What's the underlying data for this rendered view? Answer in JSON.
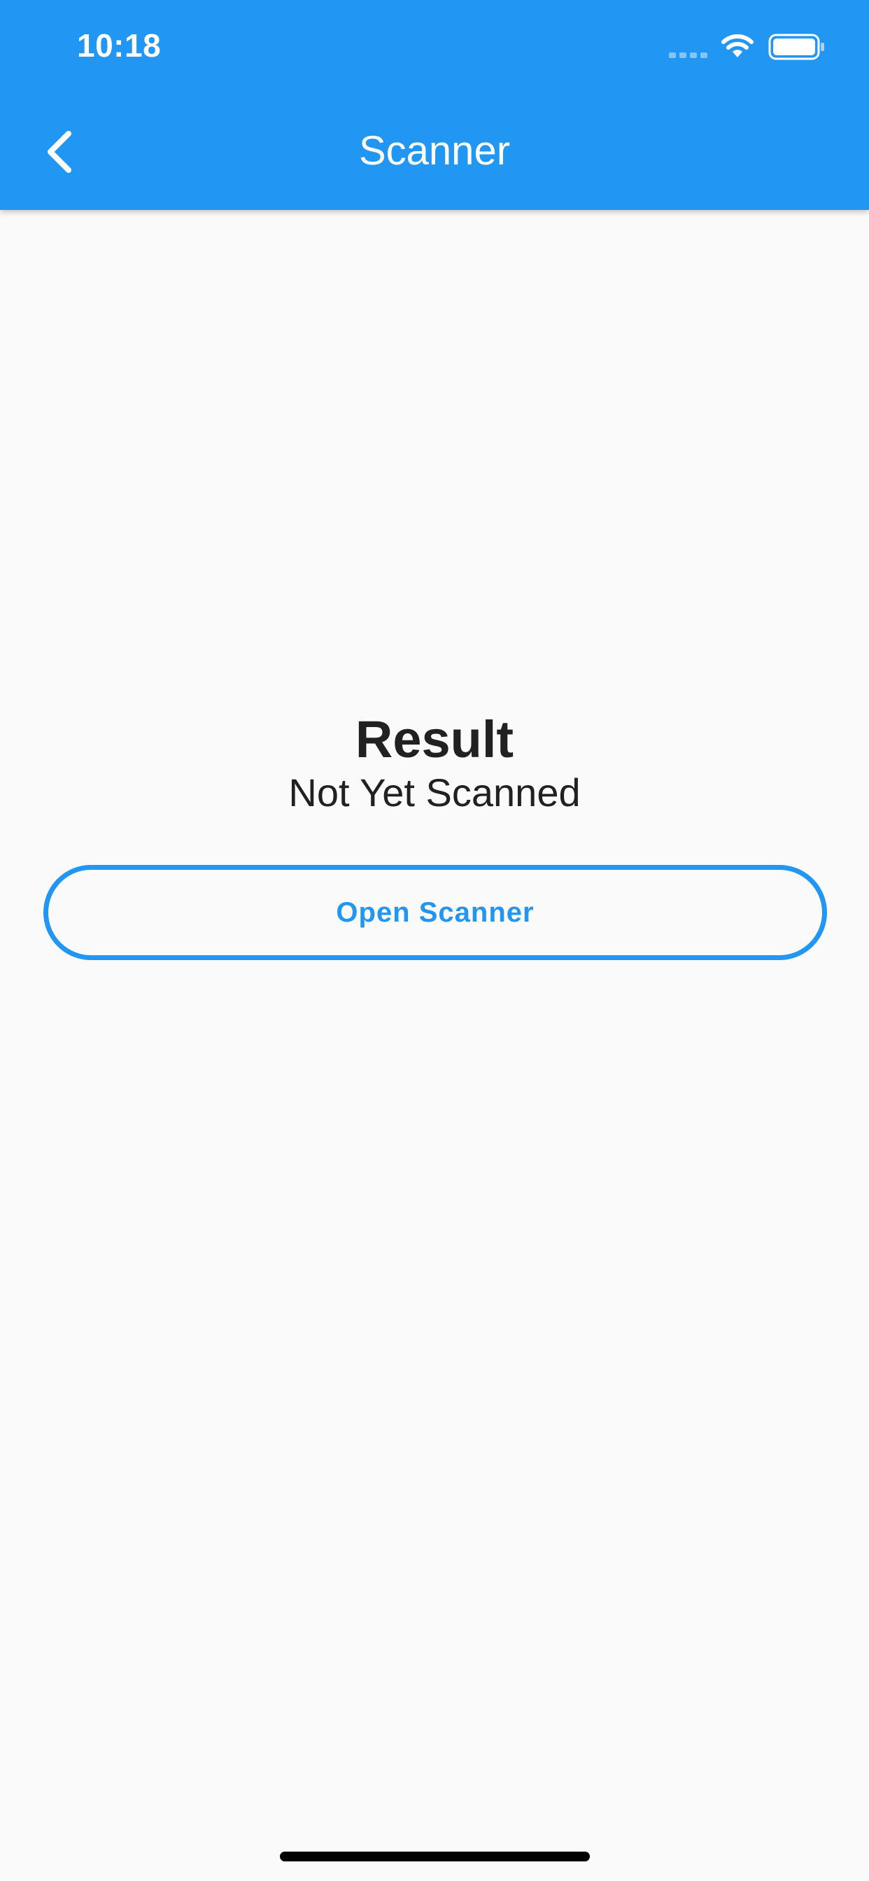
{
  "status_bar": {
    "time": "10:18"
  },
  "app_bar": {
    "title": "Scanner",
    "back_icon": "chevron-left-icon"
  },
  "main": {
    "result_label": "Result",
    "result_value": "Not Yet Scanned",
    "open_scanner_label": "Open Scanner"
  },
  "colors": {
    "primary": "#2196f3",
    "background": "#fafafa",
    "text": "#212121"
  }
}
